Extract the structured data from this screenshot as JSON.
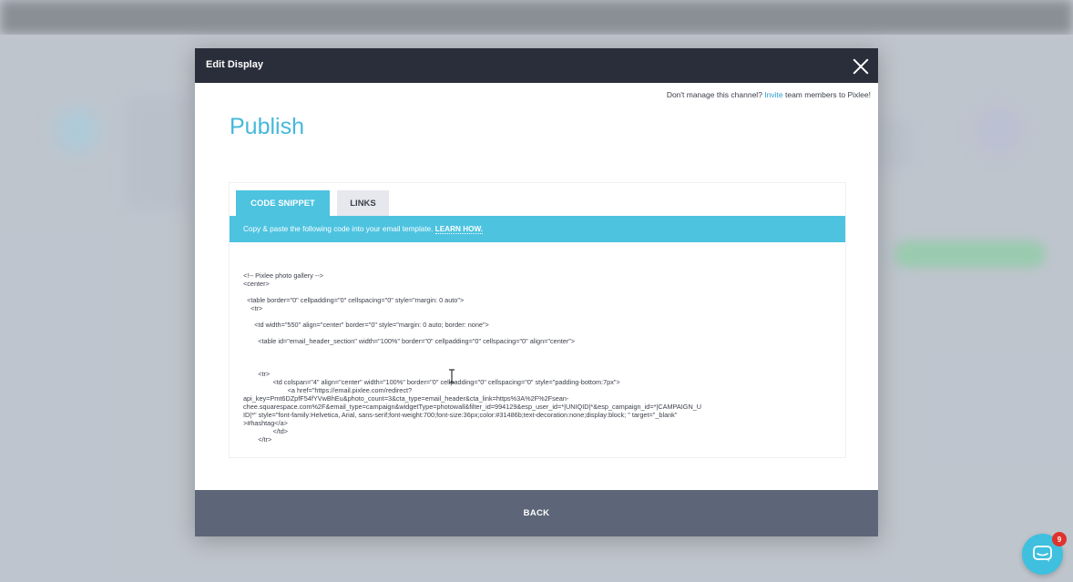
{
  "modal": {
    "title": "Edit Display",
    "invite_prefix": "Don't manage this channel? ",
    "invite_link": "Invite",
    "invite_suffix": " team members to Pixlee!",
    "heading": "Publish",
    "tabs": [
      {
        "label": "CODE SNIPPET",
        "active": true
      },
      {
        "label": "LINKS",
        "active": false
      }
    ],
    "info_text": "Copy & paste the following code into your email template. ",
    "learn_how": "LEARN HOW.",
    "code_lines": [
      "<!-- Pixlee photo gallery -->",
      "<center>",
      "",
      "  <table border=\"0\" cellpadding=\"0\" cellspacing=\"0\" style=\"margin: 0 auto\">",
      "    <tr>",
      "",
      "      <td width=\"550\" align=\"center\" border=\"0\" style=\"margin: 0 auto; border: none\">",
      "",
      "        <table id=\"email_header_section\" width=\"100%\" border=\"0\" cellpadding=\"0\" cellspacing=\"0\" align=\"center\">",
      "",
      "",
      "",
      "        <tr>",
      "                <td colspan=\"4\" align=\"center\" width=\"100%\" border=\"0\" cellpadding=\"0\" cellspacing=\"0\" style=\"padding-bottom:7px\">",
      "                        <a href=\"https://email.pixlee.com/redirect?",
      "api_key=Pmt6DZpfF54fYVwBhEu&photo_count=3&cta_type=email_header&cta_link=https%3A%2F%2Fsean-",
      "chee.squarespace.com%2F&email_type=campaign&widgetType=photowall&filter_id=994129&esp_user_id=*|UNIQID|*&esp_campaign_id=*|CAMPAIGN_U",
      "ID|*\" style=\"font-family:Helvetica, Arial, sans-serif;font-weight:700;font-size:36px;color:#31486b;text-decoration:none;display:block; \" target=\"_blank\"",
      ">#hashtag</a>",
      "                </td>",
      "        </tr>"
    ],
    "back_label": "BACK"
  },
  "chat": {
    "badge_count": "9",
    "icon": "chat-bubble-icon"
  },
  "colors": {
    "accent": "#4dc3e0",
    "header_bg": "#2a2d3a",
    "back_button_bg": "#5d6678",
    "heading_color": "#45b8dc",
    "badge": "#e0322d"
  }
}
